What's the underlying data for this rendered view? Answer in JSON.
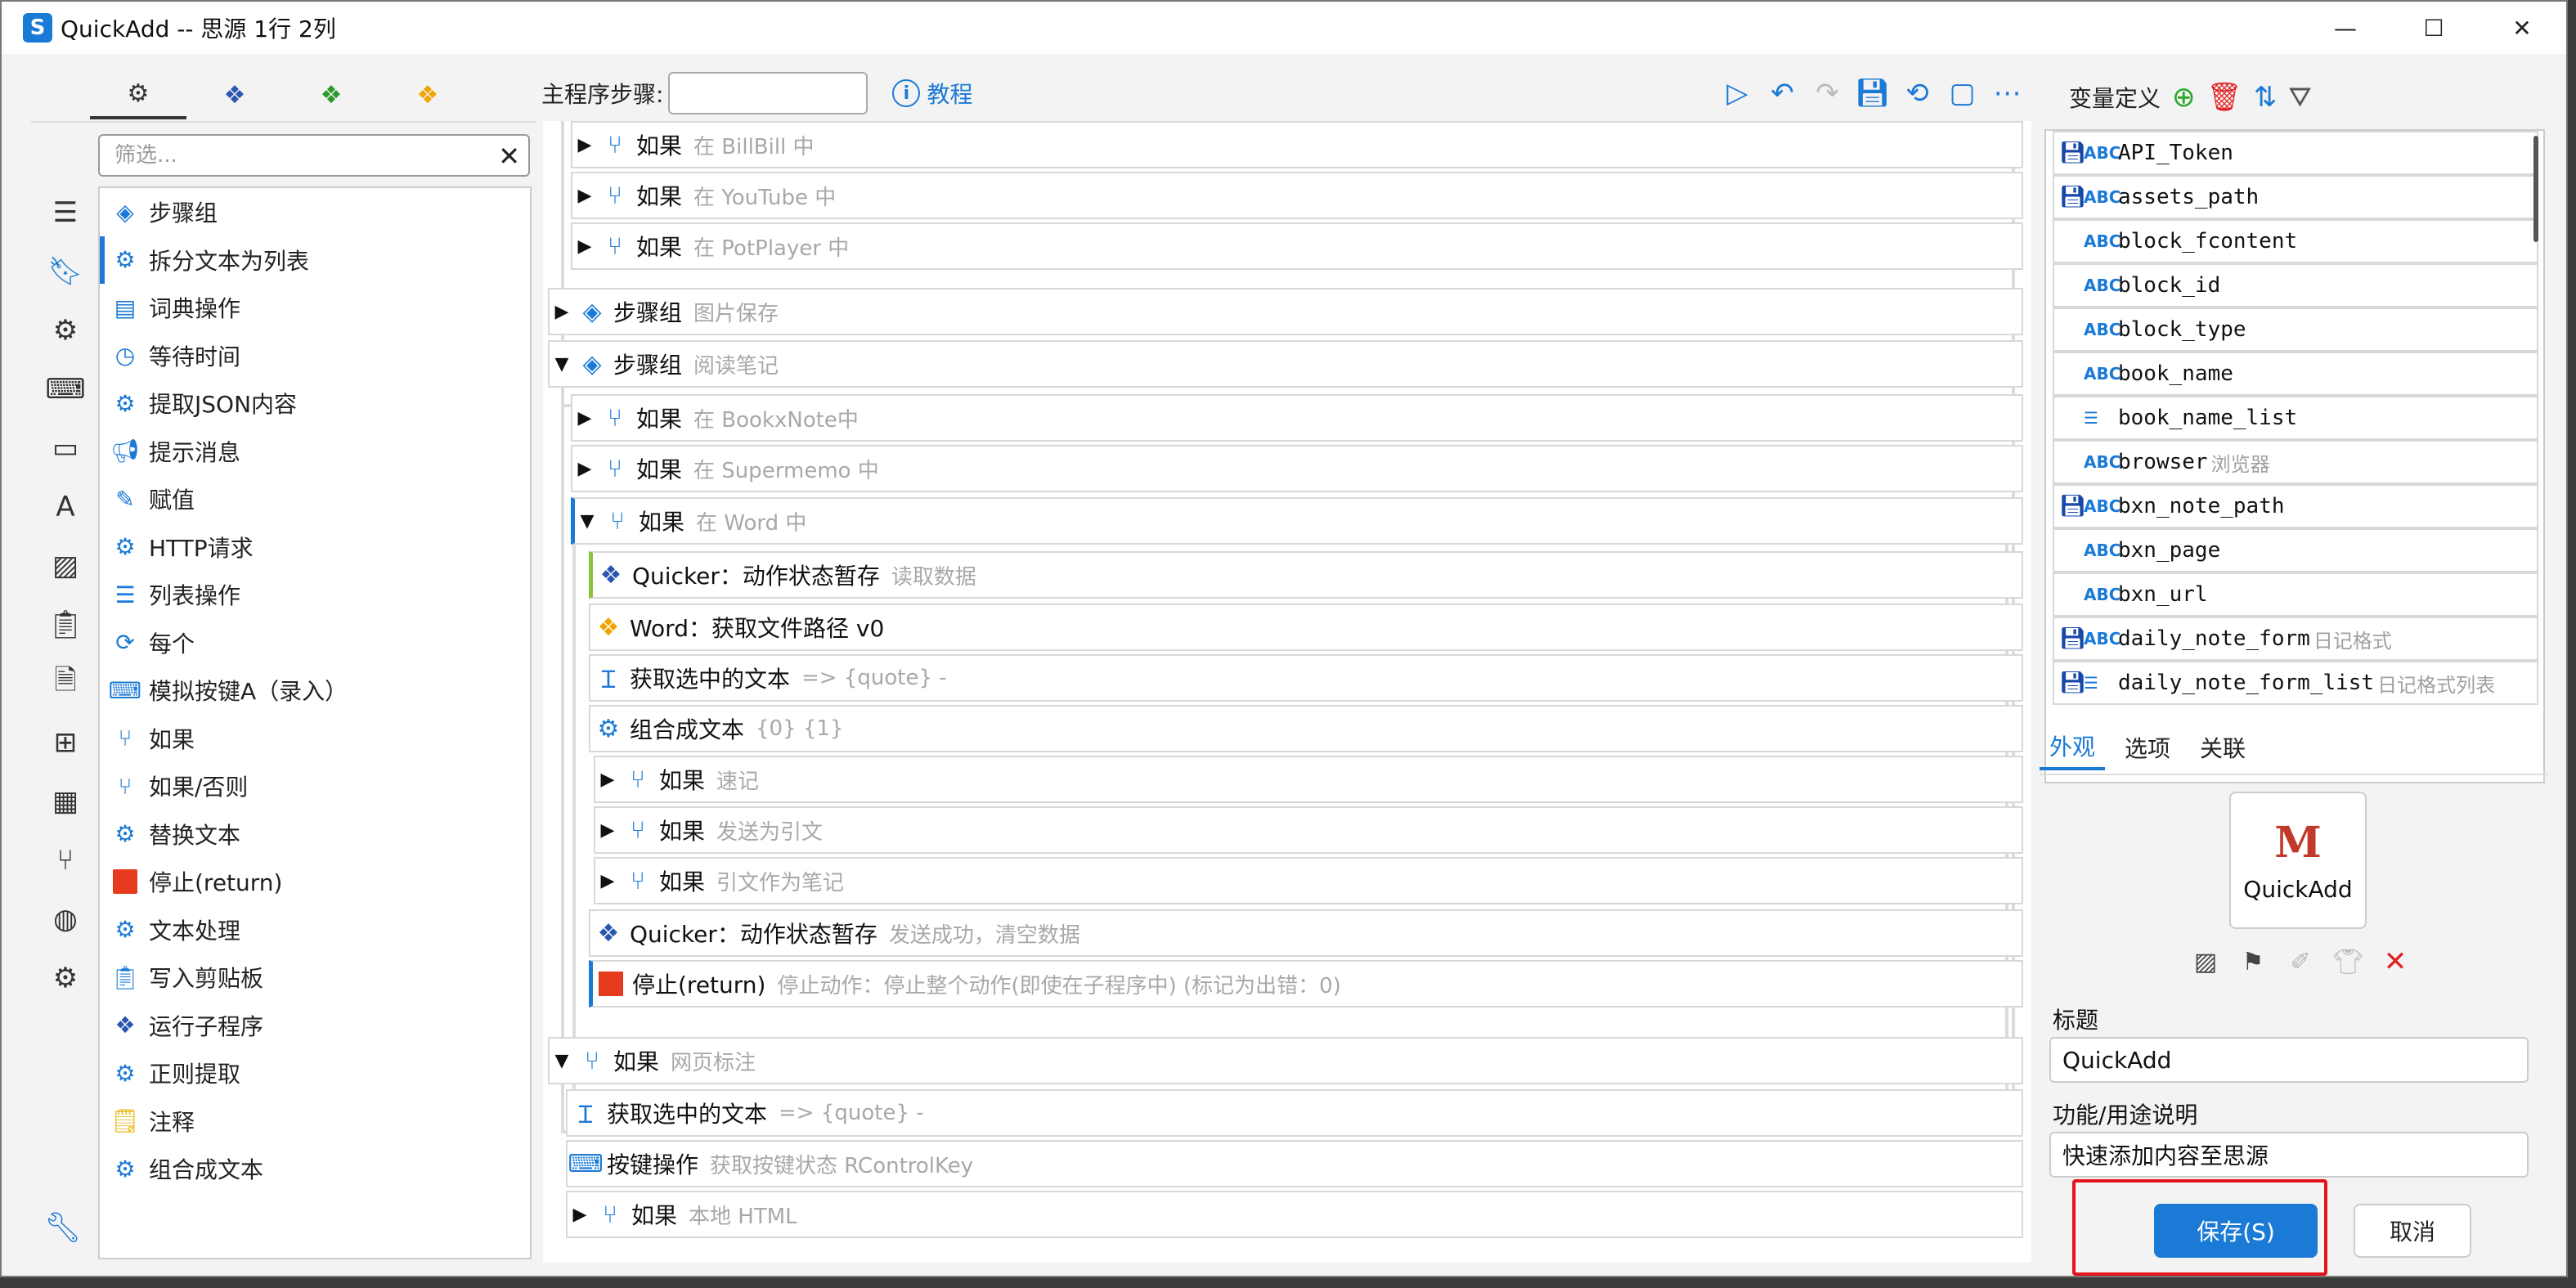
{
  "window": {
    "title": "QuickAdd -- 思源 1行 2列",
    "logo": "S",
    "minimize": "—",
    "maximize": "☐",
    "close": "✕"
  },
  "left_panel": {
    "tabs": [
      {
        "icon": "gears-icon",
        "glyph": "⚙"
      },
      {
        "icon": "blue-cubes-icon",
        "glyph": "❖"
      },
      {
        "icon": "green-cubes-icon",
        "glyph": "❖"
      },
      {
        "icon": "orange-cubes-icon",
        "glyph": "❖"
      }
    ],
    "filter_placeholder": "筛选...",
    "filter_clear": "✕",
    "rail_icons": [
      "menu-icon",
      "bookmark-icon",
      "gear-icon",
      "keyboard-icon",
      "window-icon",
      "font-icon",
      "image-icon",
      "clipboard-icon",
      "document-icon",
      "windows-icon",
      "calculator-icon",
      "branch-icon",
      "globe-icon",
      "settings-icon"
    ],
    "steps": [
      {
        "label": "步骤组",
        "icon": "layers-icon"
      },
      {
        "label": "拆分文本为列表",
        "icon": "gear-icon"
      },
      {
        "label": "词典操作",
        "icon": "book-icon"
      },
      {
        "label": "等待时间",
        "icon": "timer-icon"
      },
      {
        "label": "提取JSON内容",
        "icon": "gear-icon"
      },
      {
        "label": "提示消息",
        "icon": "megaphone-icon"
      },
      {
        "label": "赋值",
        "icon": "edit-icon"
      },
      {
        "label": "HTTP请求",
        "icon": "gear-icon"
      },
      {
        "label": "列表操作",
        "icon": "list-icon"
      },
      {
        "label": "每个",
        "icon": "loop-icon"
      },
      {
        "label": "模拟按键A（录入）",
        "icon": "keyboard-icon"
      },
      {
        "label": "如果",
        "icon": "branch-icon"
      },
      {
        "label": "如果/否则",
        "icon": "branch-icon"
      },
      {
        "label": "替换文本",
        "icon": "gear-icon"
      },
      {
        "label": "停止(return)",
        "icon": "stop-icon"
      },
      {
        "label": "文本处理",
        "icon": "gear-icon"
      },
      {
        "label": "写入剪贴板",
        "icon": "clipboard-icon"
      },
      {
        "label": "运行子程序",
        "icon": "cubes-icon"
      },
      {
        "label": "正则提取",
        "icon": "gear-icon"
      },
      {
        "label": "注释",
        "icon": "note-icon"
      },
      {
        "label": "组合成文本",
        "icon": "gear-icon"
      }
    ]
  },
  "toolbar": {
    "label": "主程序步骤:",
    "help": "教程"
  },
  "flow": {
    "rows": [
      {
        "title": "如果",
        "sub": "在 BillBill 中"
      },
      {
        "title": "如果",
        "sub": "在 YouTube 中"
      },
      {
        "title": "如果",
        "sub": "在 PotPlayer 中"
      },
      {
        "title": "步骤组",
        "sub": "图片保存"
      },
      {
        "title": "步骤组",
        "sub": "阅读笔记"
      },
      {
        "title": "如果",
        "sub": "在 BookxNote中"
      },
      {
        "title": "如果",
        "sub": "在 Supermemo 中"
      },
      {
        "title": "如果",
        "sub": "在 Word 中"
      },
      {
        "title": "Quicker：动作状态暂存",
        "sub": "读取数据"
      },
      {
        "title": "Word：获取文件路径 v0",
        "sub": ""
      },
      {
        "title": "获取选中的文本",
        "sub": "=> {quote} -"
      },
      {
        "title": "组合成文本",
        "sub": "{0} {1}"
      },
      {
        "title": "如果",
        "sub": "速记"
      },
      {
        "title": "如果",
        "sub": "发送为引文"
      },
      {
        "title": "如果",
        "sub": "引文作为笔记"
      },
      {
        "title": "Quicker：动作状态暂存",
        "sub": "发送成功，清空数据"
      },
      {
        "title": "停止(return)",
        "sub": "停止动作：停止整个动作(即使在子程序中) (标记为出错：0)"
      },
      {
        "title": "如果",
        "sub": "网页标注"
      },
      {
        "title": "获取选中的文本",
        "sub": "=> {quote} -"
      },
      {
        "title": "按键操作",
        "sub": "获取按键状态 RControlKey"
      },
      {
        "title": "如果",
        "sub": "本地 HTML"
      }
    ]
  },
  "variables": {
    "header": "变量定义",
    "items": [
      {
        "name": "API_Token",
        "desc": "",
        "saved": true,
        "type": "ABC"
      },
      {
        "name": "assets_path",
        "desc": "",
        "saved": true,
        "type": "ABC"
      },
      {
        "name": "block_fcontent",
        "desc": "",
        "saved": false,
        "type": "ABC"
      },
      {
        "name": "block_id",
        "desc": "",
        "saved": false,
        "type": "ABC"
      },
      {
        "name": "block_type",
        "desc": "",
        "saved": false,
        "type": "ABC"
      },
      {
        "name": "book_name",
        "desc": "",
        "saved": false,
        "type": "ABC"
      },
      {
        "name": "book_name_list",
        "desc": "",
        "saved": false,
        "type": "☰"
      },
      {
        "name": "browser",
        "desc": "浏览器",
        "saved": false,
        "type": "ABC"
      },
      {
        "name": "bxn_note_path",
        "desc": "",
        "saved": true,
        "type": "ABC"
      },
      {
        "name": "bxn_page",
        "desc": "",
        "saved": false,
        "type": "ABC"
      },
      {
        "name": "bxn_url",
        "desc": "",
        "saved": false,
        "type": "ABC"
      },
      {
        "name": "daily_note_form",
        "desc": "日记格式",
        "saved": true,
        "type": "ABC"
      },
      {
        "name": "daily_note_form_list",
        "desc": "日记格式列表",
        "saved": true,
        "type": "☰"
      }
    ]
  },
  "props": {
    "tabs": [
      "外观",
      "选项",
      "关联"
    ],
    "app_icon_label": "QuickAdd",
    "title_label": "标题",
    "title_value": "QuickAdd",
    "desc_label": "功能/用途说明",
    "desc_value": "快速添加内容至思源",
    "save": "保存(S)",
    "cancel": "取消"
  }
}
